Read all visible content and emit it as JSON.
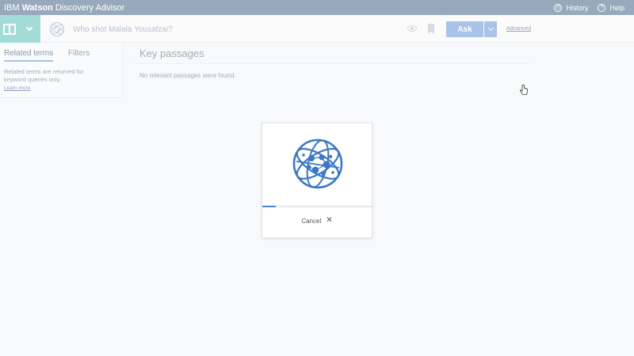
{
  "titlebar": {
    "brand_ibm": "IBM",
    "brand_watson": "Watson",
    "brand_product": "Discovery Advisor",
    "history_label": "History",
    "help_label": "Help"
  },
  "query": {
    "value": "Who shot Malala Yousafzai?",
    "ask_label": "Ask",
    "advanced_label": "Advanced"
  },
  "left_panel": {
    "tabs": [
      {
        "label": "Related terms",
        "active": true
      },
      {
        "label": "Filters",
        "active": false
      }
    ],
    "note": "Related terms are returned for keyword queries only.",
    "learn_more": "Learn more"
  },
  "main": {
    "title": "Key passages",
    "empty_message": "No relevant passages were found."
  },
  "modal": {
    "progress": 0.12,
    "cancel_label": "Cancel",
    "cancel_icon": "close-icon"
  },
  "colors": {
    "titlebar": "#98a9bd",
    "nav_toggle": "#a3dbd7",
    "ask_button": "#a9c2e8",
    "globe": "#3b78c4",
    "progress": "#4a86d9"
  }
}
